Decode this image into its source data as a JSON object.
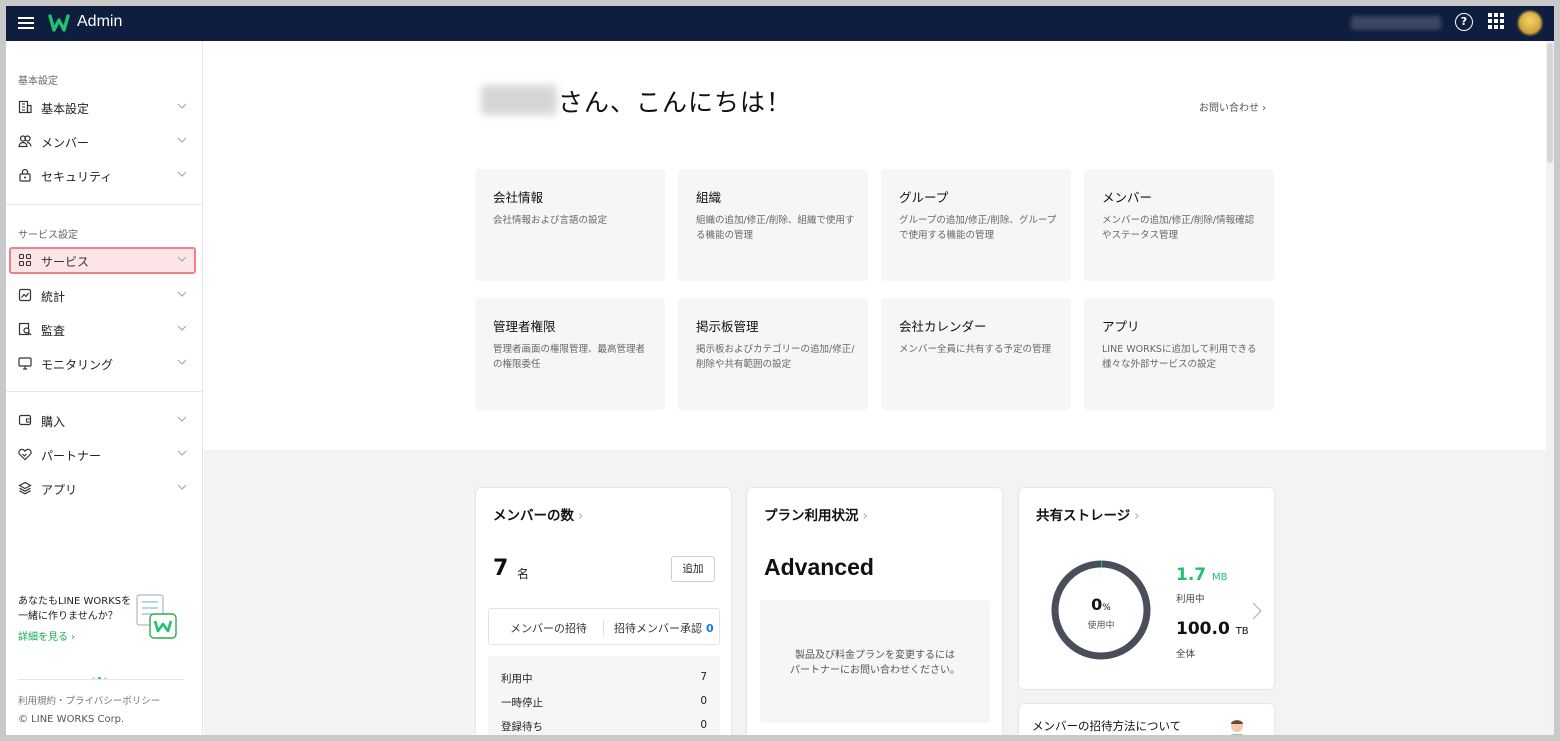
{
  "header": {
    "app_title": "Admin",
    "help_icon": "?"
  },
  "sidebar": {
    "section_basic": "基本設定",
    "section_service": "サービス設定",
    "items": [
      {
        "label": "基本設定",
        "icon": "building-icon"
      },
      {
        "label": "メンバー",
        "icon": "members-icon"
      },
      {
        "label": "セキュリティ",
        "icon": "lock-icon"
      },
      {
        "label": "サービス",
        "icon": "grid-icon"
      },
      {
        "label": "統計",
        "icon": "chart-icon"
      },
      {
        "label": "監査",
        "icon": "audit-icon"
      },
      {
        "label": "モニタリング",
        "icon": "monitor-icon"
      },
      {
        "label": "購入",
        "icon": "wallet-icon"
      },
      {
        "label": "パートナー",
        "icon": "handshake-icon"
      },
      {
        "label": "アプリ",
        "icon": "layers-icon"
      }
    ],
    "promo_line1": "あなたもLINE WORKSを",
    "promo_line2": "一緒に作りませんか？",
    "promo_link": "詳細を見る ›",
    "footer_links": "利用規約・プライバシーポリシー",
    "copyright": "© LINE WORKS Corp."
  },
  "main": {
    "greeting": "さん、こんにちは！",
    "inquiry": "お問い合わせ ›",
    "cards": [
      {
        "title": "会社情報",
        "desc": "会社情報および言語の設定"
      },
      {
        "title": "組織",
        "desc": "組織の追加/修正/削除、組織で使用する機能の管理"
      },
      {
        "title": "グループ",
        "desc": "グループの追加/修正/削除、グループで使用する機能の管理"
      },
      {
        "title": "メンバー",
        "desc": "メンバーの追加/修正/削除/情報確認やステータス管理"
      },
      {
        "title": "管理者権限",
        "desc": "管理者画面の権限管理、最高管理者の権限委任"
      },
      {
        "title": "掲示板管理",
        "desc": "掲示板およびカテゴリーの追加/修正/削除や共有範囲の設定"
      },
      {
        "title": "会社カレンダー",
        "desc": "メンバー全員に共有する予定の管理"
      },
      {
        "title": "アプリ",
        "desc": "LINE WORKSに追加して利用できる様々な外部サービスの設定"
      }
    ],
    "members_panel": {
      "title": "メンバーの数",
      "count": "7",
      "unit": "名",
      "add_label": "追加",
      "invite_label": "メンバーの招待",
      "approval_label": "招待メンバー承認",
      "approval_count": "0",
      "stats": [
        {
          "label": "利用中",
          "value": "7"
        },
        {
          "label": "一時停止",
          "value": "0"
        },
        {
          "label": "登録待ち",
          "value": "0"
        }
      ]
    },
    "plan_panel": {
      "title": "プラン利用状況",
      "plan": "Advanced",
      "note_line1": "製品及び料金プランを変更するには",
      "note_line2": "パートナーにお問い合わせください。"
    },
    "storage_panel": {
      "title": "共有ストレージ",
      "usage_percent": "0",
      "percent_unit": "%",
      "usage_label": "使用中",
      "used_value": "1.7",
      "used_unit": "MB",
      "used_label": "利用中",
      "total_value": "100.0",
      "total_unit": "TB",
      "total_label": "全体"
    },
    "guide_panel": {
      "title": "メンバーの招待方法について"
    }
  },
  "colors": {
    "topbar": "#0f1d3f",
    "accent_green": "#1fc26e",
    "active_highlight": "#f0808a",
    "link_blue": "#1877f2"
  }
}
